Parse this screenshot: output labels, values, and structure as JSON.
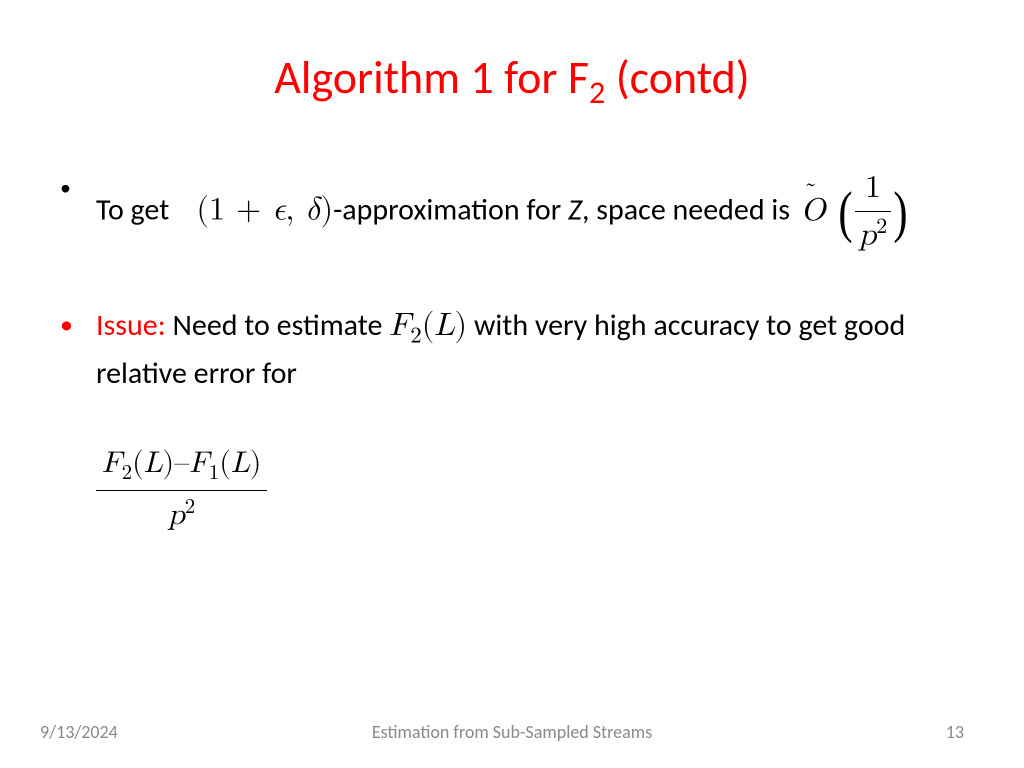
{
  "title": {
    "pre": "Algorithm 1 for F",
    "sub": "2",
    "post": " (contd)"
  },
  "bullet1": {
    "t1": "To get",
    "math_approx": "(1 + ϵ, δ)",
    "t2": "-approximation for ",
    "zvar": "Z",
    "t3": ", space needed is",
    "otilde_O": "O",
    "otilde_tilde": "˜",
    "frac_num": "1",
    "frac_den_p": "p",
    "frac_den_exp": "2"
  },
  "bullet2": {
    "issue": "Issue:",
    "t1": " Need to estimate ",
    "f2l_f": "F",
    "f2l_sub": "2",
    "f2l_arg": "(L)",
    "t2": "  with very high accuracy to get good relative error for"
  },
  "bigfrac": {
    "f2_f": "F",
    "f2_sub": "2",
    "f2_arg": "(L)",
    "minus": "–",
    "f1_f": "F",
    "f1_sub": "1",
    "f1_arg": "(L)",
    "den_p": "p",
    "den_exp": "2"
  },
  "footer": {
    "date": "9/13/2024",
    "center": "Estimation from Sub-Sampled Streams",
    "page": "13"
  }
}
